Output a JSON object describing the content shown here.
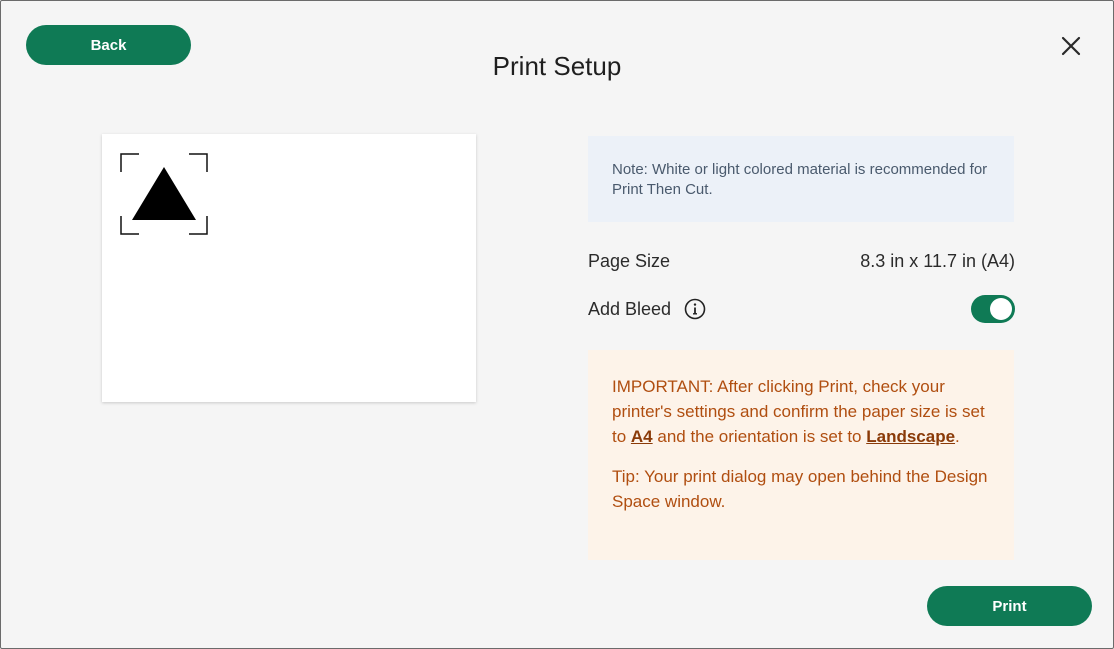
{
  "dialog": {
    "title": "Print Setup",
    "back_label": "Back",
    "print_label": "Print",
    "close_icon": "close-icon"
  },
  "note": {
    "text": "Note: White or light colored material is recommended for Print Then Cut."
  },
  "page_size": {
    "label": "Page Size",
    "value": "8.3 in x 11.7 in (A4)"
  },
  "bleed": {
    "label": "Add Bleed",
    "info_icon": "info-icon",
    "enabled": true
  },
  "important": {
    "part1": "IMPORTANT: After clicking Print, check your printer's settings and confirm the paper size is set to ",
    "paper_size": "A4",
    "part2": " and the orientation is set to ",
    "orientation": "Landscape",
    "part3": ".",
    "tip": "Tip: Your print dialog may open behind the Design Space window."
  },
  "colors": {
    "accent": "#0f7a55",
    "note_bg": "#ecf1f8",
    "important_bg": "#fdf3e9",
    "important_text": "#b04e10"
  }
}
